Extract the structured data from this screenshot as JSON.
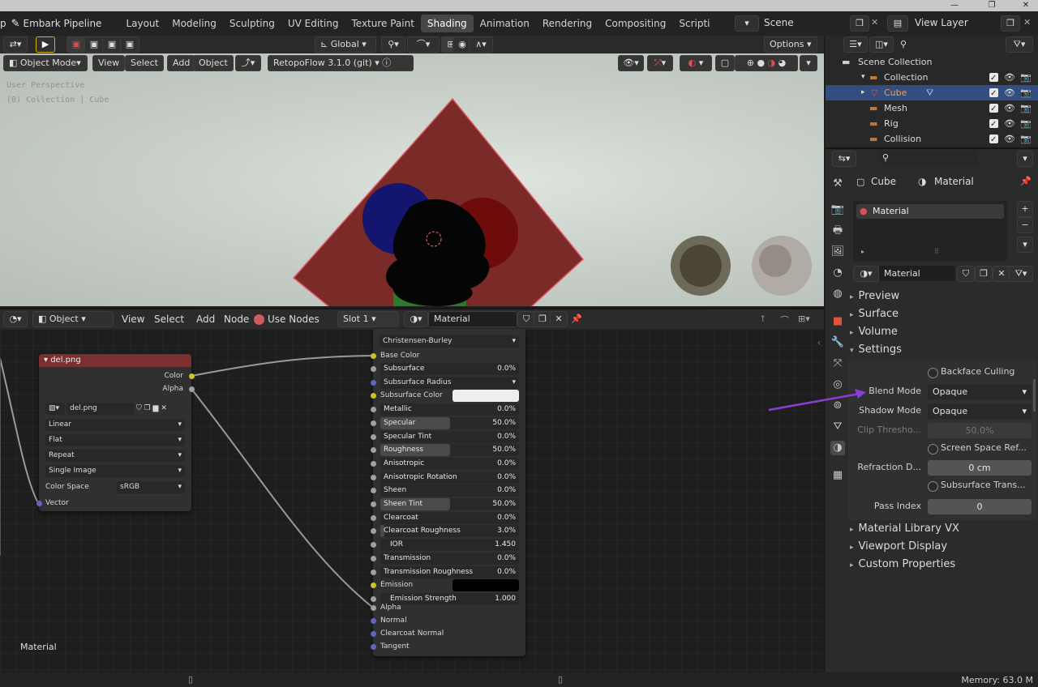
{
  "app": {
    "window_controls": [
      "—",
      "❐",
      "✕"
    ]
  },
  "topbar": {
    "menu_fragment": "p",
    "file_name": "Embark Pipeline",
    "tabs": [
      {
        "label": "Layout",
        "active": false
      },
      {
        "label": "Modeling",
        "active": false
      },
      {
        "label": "Sculpting",
        "active": false
      },
      {
        "label": "UV Editing",
        "active": false
      },
      {
        "label": "Texture Paint",
        "active": false
      },
      {
        "label": "Shading",
        "active": true
      },
      {
        "label": "Animation",
        "active": false
      },
      {
        "label": "Rendering",
        "active": false
      },
      {
        "label": "Compositing",
        "active": false
      },
      {
        "label": "Scripti",
        "active": false
      }
    ],
    "scene_label": "Scene",
    "view_layer_label": "View Layer"
  },
  "viewport": {
    "orientation": "Global",
    "options_label": "Options",
    "mode": "Object Mode",
    "menus": [
      "View",
      "Select",
      "Add",
      "Object"
    ],
    "addon": "RetopoFlow 3.1.0 (git)",
    "overlay_line1": "User Perspective",
    "overlay_line2": "(0) Collection | Cube",
    "colors": {
      "plane": "#7a2a27",
      "blue_circle": "#14156e",
      "red_circle": "#6e0c0c",
      "green": "#2a7a2a"
    }
  },
  "node_editor": {
    "editor_type": "Object",
    "menus": [
      "View",
      "Select",
      "Add",
      "Node"
    ],
    "use_nodes_label": "Use Nodes",
    "slot_label": "Slot 1",
    "material_name": "Material",
    "footer_label": "Material",
    "image_node": {
      "title": "del.png",
      "outputs": [
        "Color",
        "Alpha"
      ],
      "image_name": "del.png",
      "interpolation": "Linear",
      "projection": "Flat",
      "extension": "Repeat",
      "source": "Single Image",
      "color_space_label": "Color Space",
      "color_space_value": "sRGB",
      "input_vector": "Vector"
    },
    "bsdf_node": {
      "subsurface_method": "Christensen-Burley",
      "base_color_label": "Base Color",
      "rows": [
        {
          "label": "Subsurface",
          "value": "0.0%",
          "fill": 0
        },
        {
          "label": "Subsurface Radius",
          "value": "",
          "dropdown": true
        },
        {
          "label": "Subsurface Color",
          "value": "",
          "color": "#eeeeee"
        },
        {
          "label": "Metallic",
          "value": "0.0%",
          "fill": 0
        },
        {
          "label": "Specular",
          "value": "50.0%",
          "fill": 0.5
        },
        {
          "label": "Specular Tint",
          "value": "0.0%",
          "fill": 0
        },
        {
          "label": "Roughness",
          "value": "50.0%",
          "fill": 0.5
        },
        {
          "label": "Anisotropic",
          "value": "0.0%",
          "fill": 0
        },
        {
          "label": "Anisotropic Rotation",
          "value": "0.0%",
          "fill": 0
        },
        {
          "label": "Sheen",
          "value": "0.0%",
          "fill": 0
        },
        {
          "label": "Sheen Tint",
          "value": "50.0%",
          "fill": 0.5
        },
        {
          "label": "Clearcoat",
          "value": "0.0%",
          "fill": 0
        },
        {
          "label": "Clearcoat Roughness",
          "value": "3.0%",
          "fill": 0.03
        },
        {
          "label": "IOR",
          "value": "1.450",
          "fill": 0
        },
        {
          "label": "Transmission",
          "value": "0.0%",
          "fill": 0
        },
        {
          "label": "Transmission Roughness",
          "value": "0.0%",
          "fill": 0
        },
        {
          "label": "Emission",
          "value": "",
          "color": "#000000"
        },
        {
          "label": "Emission Strength",
          "value": "1.000",
          "fill": 0
        }
      ],
      "bottom_inputs": [
        "Alpha",
        "Normal",
        "Clearcoat Normal",
        "Tangent"
      ]
    }
  },
  "outliner": {
    "items": [
      {
        "label": "Scene Collection",
        "indent": 0
      },
      {
        "label": "Collection",
        "indent": 1
      },
      {
        "label": "Cube",
        "indent": 2,
        "selected": true
      },
      {
        "label": "Mesh",
        "indent": 1
      },
      {
        "label": "Rig",
        "indent": 1
      },
      {
        "label": "Collision",
        "indent": 1
      }
    ]
  },
  "properties": {
    "breadcrumb_object": "Cube",
    "breadcrumb_material": "Material",
    "slot_item": "Material",
    "material_datablock": "Material",
    "panels_top": [
      "Preview",
      "Surface",
      "Volume",
      "Settings"
    ],
    "settings": {
      "backface_culling": "Backface Culling",
      "blend_mode_label": "Blend Mode",
      "blend_mode_value": "Opaque",
      "shadow_mode_label": "Shadow Mode",
      "shadow_mode_value": "Opaque",
      "clip_threshold_label": "Clip Thresho...",
      "clip_threshold_value": "50.0%",
      "screen_space_refraction": "Screen Space Ref...",
      "refraction_depth_label": "Refraction D...",
      "refraction_depth_value": "0 cm",
      "subsurface_translucency": "Subsurface Trans...",
      "pass_index_label": "Pass Index",
      "pass_index_value": "0"
    },
    "panels_bottom": [
      "Material Library VX",
      "Viewport Display",
      "Custom Properties"
    ],
    "annotation_arrow_color": "#8a3cd6"
  },
  "statusbar": {
    "memory": "Memory: 63.0 M"
  }
}
